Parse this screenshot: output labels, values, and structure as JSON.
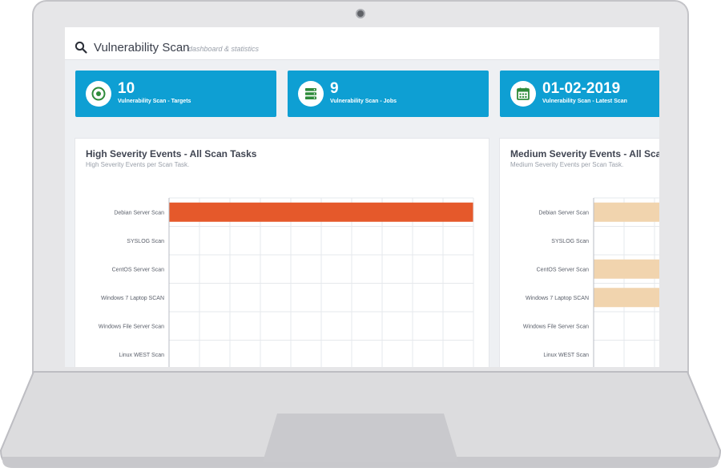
{
  "header": {
    "title": "Vulnerability Scan",
    "subtitle": "dashboard & statistics"
  },
  "stats": [
    {
      "value": "10",
      "label": "Vulnerability Scan - Targets",
      "icon": "target-icon"
    },
    {
      "value": "9",
      "label": "Vulnerability Scan - Jobs",
      "icon": "server-icon"
    },
    {
      "value": "01-02-2019",
      "label": "Vulnerability Scan - Latest Scan",
      "icon": "calendar-icon"
    }
  ],
  "colors": {
    "accent": "#0e9fd3",
    "high": "#e5592b",
    "medium": "#f1d4ae",
    "icon_green": "#2e8b3a"
  },
  "panels": [
    {
      "title": "High Severity Events - All Scan Tasks",
      "subtitle": "High Severity Events per Scan Task."
    },
    {
      "title": "Medium Severity Events - All Scan Tasks",
      "subtitle": "Medium Severity Events per Scan Task."
    }
  ],
  "chart_data": [
    {
      "type": "bar",
      "orientation": "horizontal",
      "title": "High Severity Events - All Scan Tasks",
      "subtitle": "High Severity Events per Scan Task.",
      "categories": [
        "Debian Server Scan",
        "SYSLOG Scan",
        "CentOS Server Scan",
        "Windows 7 Laptop SCAN",
        "Windows File Server Scan",
        "Linux WEST Scan"
      ],
      "values": [
        1,
        0,
        0,
        0,
        0,
        0
      ],
      "xlim": [
        0,
        1
      ],
      "grid": true,
      "color": "#e5592b"
    },
    {
      "type": "bar",
      "orientation": "horizontal",
      "title": "Medium Severity Events - All Scan Tasks",
      "subtitle": "Medium Severity Events per Scan Task.",
      "categories": [
        "Debian Server Scan",
        "SYSLOG Scan",
        "CentOS Server Scan",
        "Windows 7 Laptop SCAN",
        "Windows File Server Scan",
        "Linux WEST Scan"
      ],
      "values": [
        1,
        0,
        1,
        1,
        0,
        0
      ],
      "xlim": [
        0,
        1
      ],
      "grid": true,
      "color": "#f1d4ae"
    }
  ]
}
